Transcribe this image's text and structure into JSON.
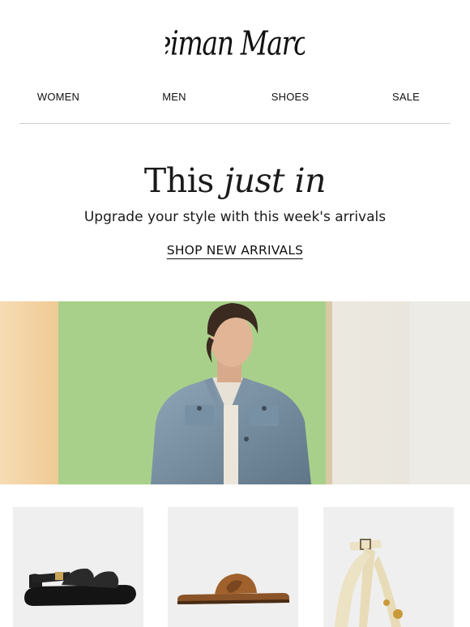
{
  "brand": {
    "logo_text": "Neiman Marcus"
  },
  "nav": {
    "items": [
      {
        "label": "WOMEN"
      },
      {
        "label": "MEN"
      },
      {
        "label": "SHOES"
      },
      {
        "label": "SALE"
      }
    ]
  },
  "hero": {
    "title_regular": "This",
    "title_italic": "just in",
    "subtitle": "Upgrade your style with this week's arrivals",
    "cta_label": "SHOP NEW ARRIVALS"
  },
  "colors": {
    "text": "#111111",
    "divider": "#cfcfcf",
    "product_tile_bg": "#efefef",
    "hero_wall_green": "#a9d08a",
    "hero_wall_peach": "#f3cf9c"
  },
  "images": {
    "hero": "man-in-denim-jacket-photo",
    "products": [
      {
        "icon": "black-sandal-image"
      },
      {
        "icon": "brown-slide-sandal-image"
      },
      {
        "icon": "cream-heeled-sandal-image"
      }
    ]
  }
}
